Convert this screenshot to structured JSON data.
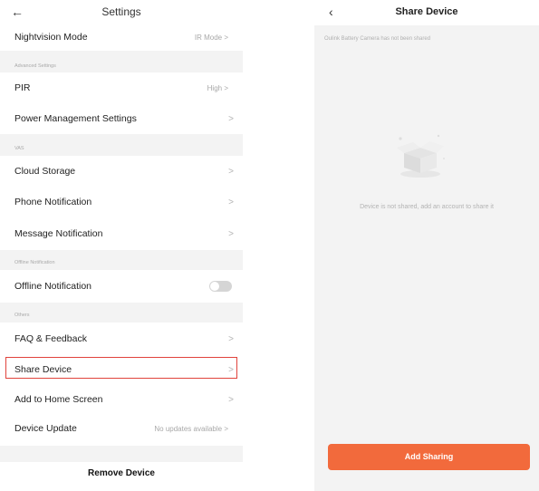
{
  "settings": {
    "title": "Settings",
    "nightvision": {
      "label": "Nightvision Mode",
      "value": "IR Mode"
    },
    "sections": {
      "advanced": "Advanced Settings",
      "vas": "VAS",
      "offline": "Offline Notification",
      "others": "Others"
    },
    "pir": {
      "label": "PIR",
      "value": "High"
    },
    "power": {
      "label": "Power Management Settings"
    },
    "cloud": {
      "label": "Cloud Storage"
    },
    "phone_notification": {
      "label": "Phone Notification"
    },
    "message_notification": {
      "label": "Message Notification"
    },
    "offline_notification": {
      "label": "Offline Notification",
      "enabled": false
    },
    "faq": {
      "label": "FAQ & Feedback"
    },
    "share": {
      "label": "Share Device"
    },
    "home_screen": {
      "label": "Add to Home Screen"
    },
    "device_update": {
      "label": "Device Update",
      "value": "No updates available"
    },
    "remove_label": "Remove Device",
    "chevron": ">"
  },
  "share_device": {
    "title": "Share Device",
    "note": "Oulink Battery Camera  has not been shared",
    "empty_message": "Device is not shared, add an account to share it",
    "add_button": "Add Sharing"
  },
  "colors": {
    "accent": "#f26a3c",
    "highlight_border": "#e0433c",
    "gray_background": "#f3f3f3"
  },
  "icons": {
    "back": "arrow-left-icon",
    "chevron": "chevron-right-icon",
    "empty": "empty-box-icon"
  }
}
